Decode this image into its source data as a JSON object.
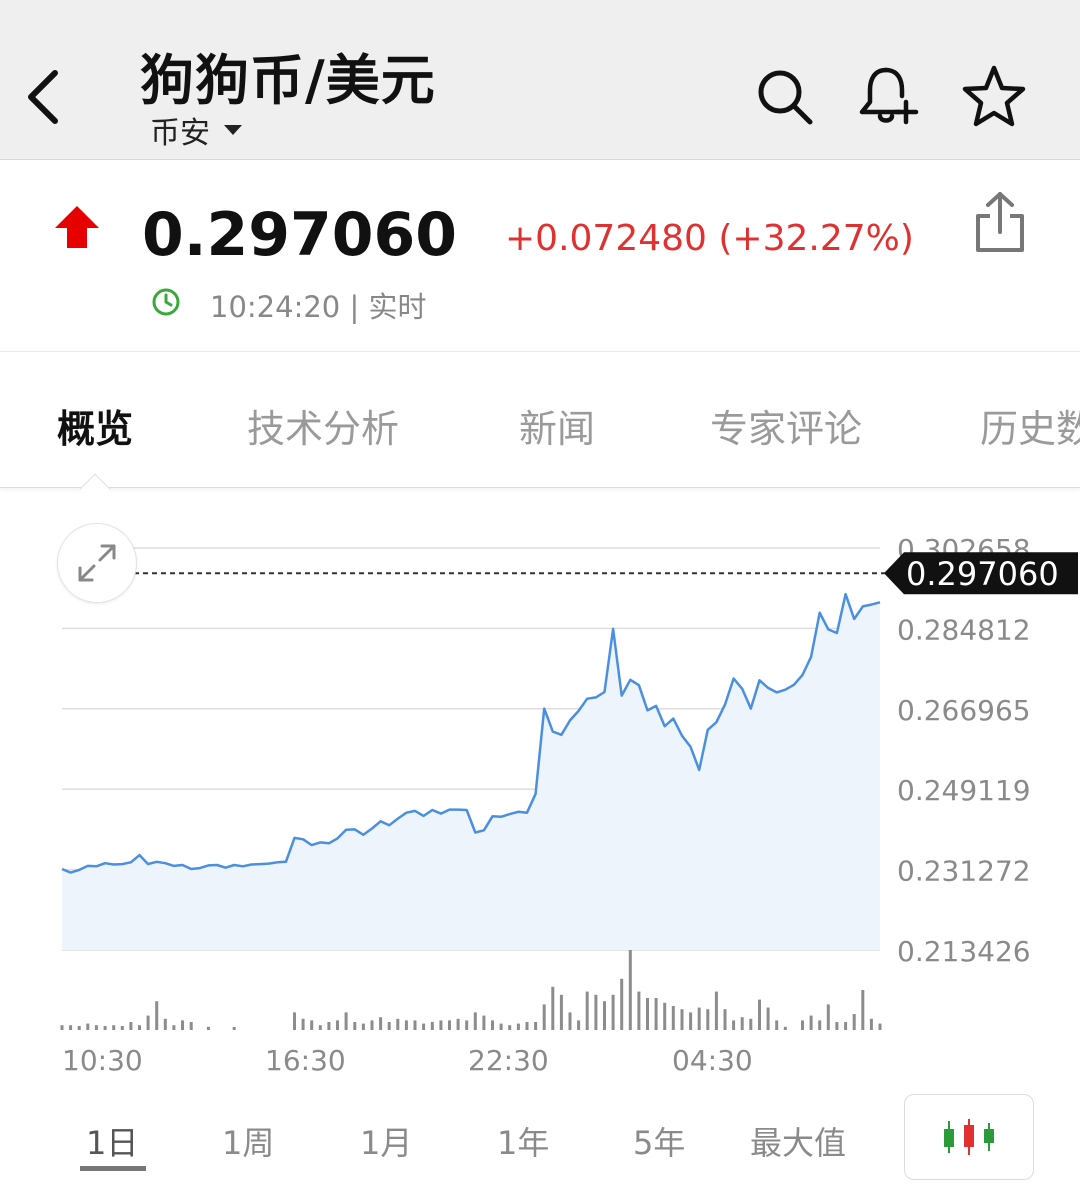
{
  "header": {
    "title": "狗狗币/美元",
    "exchange": "币安",
    "icons": [
      "back-icon",
      "search-icon",
      "bell-plus-icon",
      "star-icon",
      "share-icon",
      "clock-icon",
      "expand-icon",
      "candlestick-icon"
    ]
  },
  "quote": {
    "price": "0.297060",
    "change": "+0.072480 (+32.27%)",
    "time": "10:24:20 | 实时",
    "up_color": "#e60000",
    "change_color": "#e03131",
    "clock_color": "#3aa83a"
  },
  "tabs": [
    "概览",
    "技术分析",
    "新闻",
    "专家评论",
    "历史数据"
  ],
  "ranges": [
    "1日",
    "1周",
    "1月",
    "1年",
    "5年",
    "最大值"
  ],
  "chart_data": {
    "type": "area",
    "y_ticks": [
      "0.302658",
      "0.284812",
      "0.266965",
      "0.249119",
      "0.231272",
      "0.213426"
    ],
    "y_tick_values": [
      0.302658,
      0.284812,
      0.266965,
      0.249119,
      0.231272,
      0.213426
    ],
    "x_ticks": [
      "10:30",
      "16:30",
      "22:30",
      "04:30"
    ],
    "ylim": [
      0.213426,
      0.302658
    ],
    "current_label": "0.297060",
    "current_value": 0.29706,
    "line_color": "#4a8fe0",
    "fill_color": "#eef4fc",
    "values": [
      0.2314,
      0.2306,
      0.2312,
      0.2321,
      0.232,
      0.2327,
      0.2324,
      0.2325,
      0.2329,
      0.2345,
      0.2325,
      0.233,
      0.2327,
      0.2321,
      0.2323,
      0.2314,
      0.2316,
      0.2322,
      0.2323,
      0.2317,
      0.2323,
      0.232,
      0.2324,
      0.2325,
      0.2326,
      0.2329,
      0.233,
      0.2383,
      0.238,
      0.2367,
      0.2373,
      0.2371,
      0.2382,
      0.2401,
      0.2402,
      0.239,
      0.2404,
      0.242,
      0.2411,
      0.2426,
      0.2439,
      0.2443,
      0.2432,
      0.2445,
      0.2437,
      0.2446,
      0.2446,
      0.2445,
      0.2395,
      0.24,
      0.2431,
      0.243,
      0.2436,
      0.2441,
      0.2439,
      0.2481,
      0.267,
      0.2619,
      0.2612,
      0.2644,
      0.2665,
      0.2692,
      0.2695,
      0.2707,
      0.2847,
      0.2699,
      0.2734,
      0.2722,
      0.2666,
      0.2676,
      0.2631,
      0.2648,
      0.261,
      0.2585,
      0.2534,
      0.2623,
      0.264,
      0.2679,
      0.2737,
      0.2714,
      0.267,
      0.2733,
      0.2716,
      0.2706,
      0.2712,
      0.2723,
      0.2745,
      0.2785,
      0.2883,
      0.2846,
      0.2838,
      0.2924,
      0.2869,
      0.2897,
      0.2901,
      0.2906
    ],
    "volumes": [
      0.06,
      0.06,
      0.05,
      0.08,
      0.06,
      0.05,
      0.06,
      0.05,
      0.1,
      0.06,
      0.18,
      0.36,
      0.14,
      0.06,
      0.12,
      0.1,
      0,
      0.04,
      0,
      0,
      0.02,
      0,
      0,
      0,
      0,
      0,
      0,
      0.22,
      0.14,
      0.12,
      0.06,
      0.1,
      0.12,
      0.22,
      0.1,
      0.08,
      0.12,
      0.16,
      0.1,
      0.14,
      0.12,
      0.12,
      0.08,
      0.1,
      0.12,
      0.12,
      0.14,
      0.12,
      0.22,
      0.18,
      0.12,
      0.08,
      0.06,
      0.08,
      0.1,
      0.1,
      0.32,
      0.54,
      0.44,
      0.22,
      0.12,
      0.48,
      0.44,
      0.36,
      0.44,
      0.64,
      1.0,
      0.48,
      0.4,
      0.4,
      0.34,
      0.3,
      0.26,
      0.22,
      0.28,
      0.26,
      0.48,
      0.26,
      0.12,
      0.16,
      0.14,
      0.38,
      0.28,
      0.12,
      0.04,
      0,
      0.12,
      0.18,
      0.12,
      0.32,
      0.1,
      0.1,
      0.2,
      0.5,
      0.14,
      0.08
    ]
  }
}
